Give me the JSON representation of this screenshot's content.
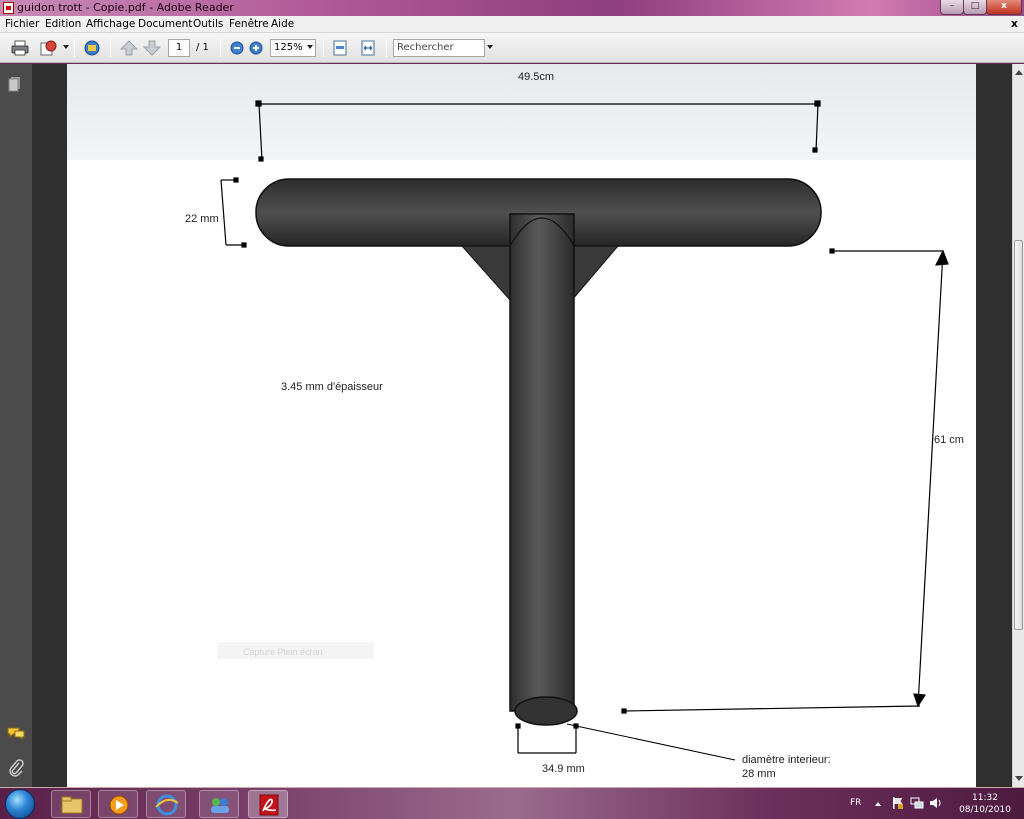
{
  "window": {
    "title": "guidon trott - Copie.pdf - Adobe Reader",
    "minimize": "–",
    "maximize": "□",
    "close": "x"
  },
  "menu": {
    "items": [
      "Fichier",
      "Edition",
      "Affichage",
      "Document",
      "Outils",
      "Fenêtre",
      "Aide"
    ],
    "doc_close": "x"
  },
  "toolbar": {
    "page_current": "1",
    "page_total": "/ 1",
    "zoom": "125%",
    "search_placeholder": "Rechercher"
  },
  "drawing": {
    "bar_width": "49.5cm",
    "bar_diameter": "22 mm",
    "thickness": "3.45 mm d'épaisseur",
    "height": "61 cm",
    "tube_diameter": "34.9 mm",
    "inner_diameter_line1": "diamètre interieur:",
    "inner_diameter_line2": "28 mm",
    "watermark": "Capture Plein écran"
  },
  "taskbar": {
    "language": "FR",
    "time": "11:32",
    "date": "08/10/2010"
  },
  "colors": {
    "tube": "#4a4a4a",
    "tube_dark": "#2a2a2a",
    "dim_line": "#000000",
    "panel": "#4b4b4b"
  }
}
